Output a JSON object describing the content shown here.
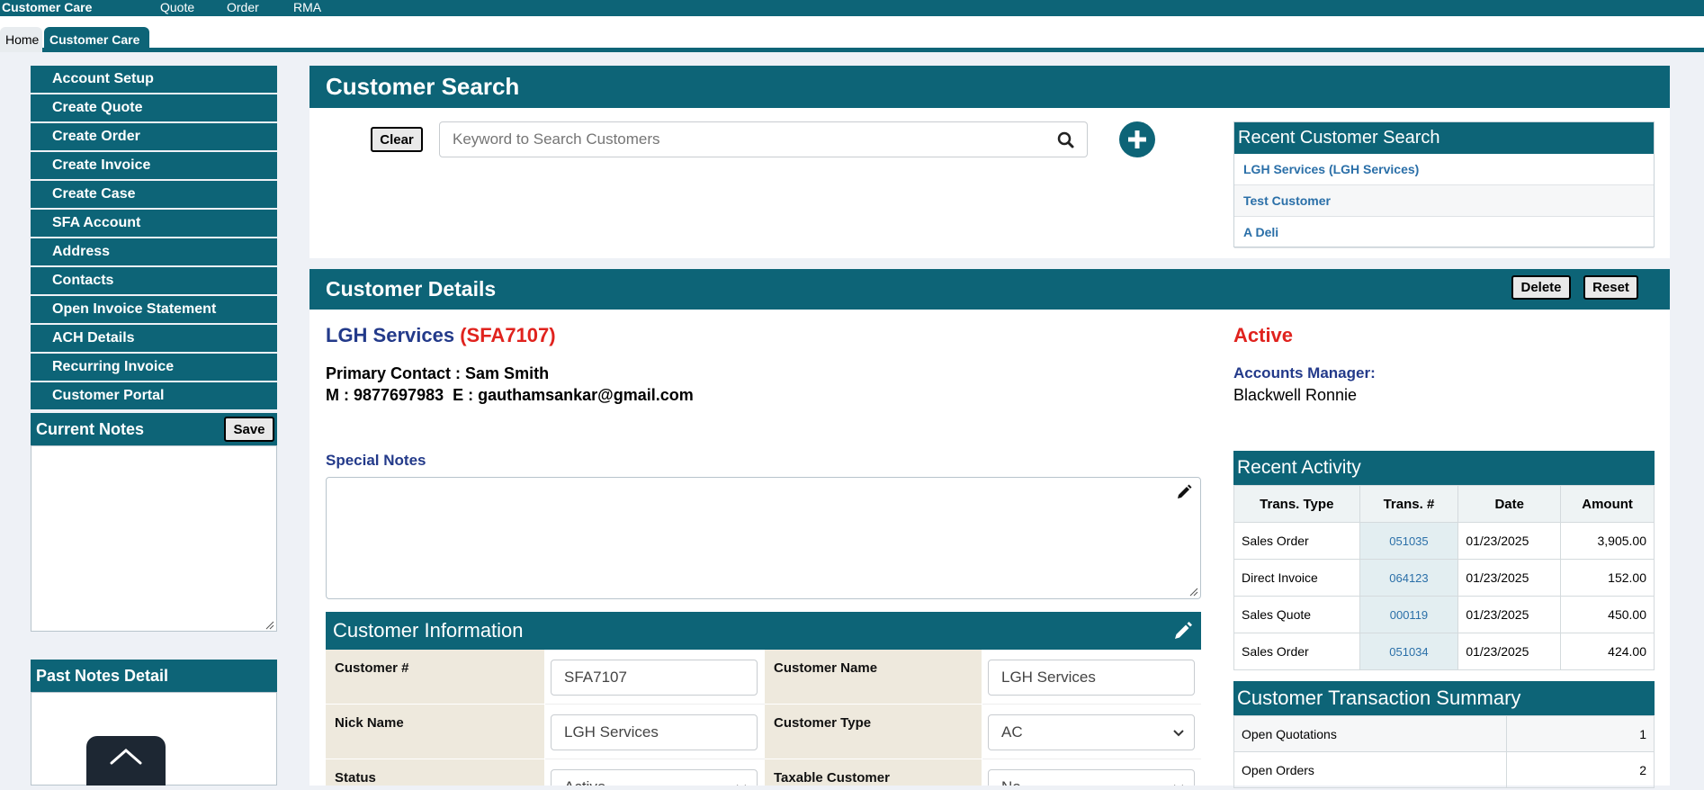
{
  "topbar": {
    "brand": "Customer Care",
    "nav": [
      "Quote",
      "Order",
      "RMA"
    ]
  },
  "tabs": {
    "home": "Home",
    "active": "Customer Care"
  },
  "sidebar": {
    "items": [
      "Account Setup",
      "Create Quote",
      "Create Order",
      "Create Invoice",
      "Create Case",
      "SFA Account",
      "Address",
      "Contacts",
      "Open Invoice Statement",
      "ACH Details",
      "Recurring Invoice",
      "Customer Portal"
    ],
    "current_notes_title": "Current Notes",
    "save_label": "Save",
    "past_notes_title": "Past Notes Detail"
  },
  "search": {
    "title": "Customer Search",
    "clear_label": "Clear",
    "placeholder": "Keyword to Search Customers",
    "recent_title": "Recent Customer Search",
    "recent_items": [
      "LGH Services (LGH Services)",
      "Test Customer",
      "A Deli"
    ]
  },
  "details": {
    "title": "Customer Details",
    "delete_label": "Delete",
    "reset_label": "Reset",
    "customer_name": "LGH Services",
    "customer_code": "(SFA7107)",
    "primary_contact": "Primary Contact : Sam Smith",
    "contact_line": "M : 9877697983  E : gauthamsankar@gmail.com",
    "status": "Active",
    "accounts_manager_label": "Accounts Manager:",
    "accounts_manager": "Blackwell Ronnie",
    "special_notes_label": "Special Notes"
  },
  "customer_info": {
    "title": "Customer Information",
    "rows": [
      {
        "label1": "Customer #",
        "value1": "SFA7107",
        "label2": "Customer Name",
        "value2": "LGH Services",
        "select2": false
      },
      {
        "label1": "Nick Name",
        "value1": "LGH Services",
        "label2": "Customer Type",
        "value2": "AC",
        "select2": true
      },
      {
        "label1": "Status",
        "value1": "Active",
        "label2": "Taxable Customer",
        "value2": "No",
        "select2": true
      }
    ]
  },
  "recent_activity": {
    "title": "Recent Activity",
    "headers": [
      "Trans. Type",
      "Trans. #",
      "Date",
      "Amount"
    ],
    "rows": [
      {
        "type": "Sales Order",
        "num": "051035",
        "date": "01/23/2025",
        "amount": "3,905.00"
      },
      {
        "type": "Direct Invoice",
        "num": "064123",
        "date": "01/23/2025",
        "amount": "152.00"
      },
      {
        "type": "Sales Quote",
        "num": "000119",
        "date": "01/23/2025",
        "amount": "450.00"
      },
      {
        "type": "Sales Order",
        "num": "051034",
        "date": "01/23/2025",
        "amount": "424.00"
      }
    ]
  },
  "transaction_summary": {
    "title": "Customer Transaction Summary",
    "rows": [
      {
        "label": "Open Quotations",
        "value": "1"
      },
      {
        "label": "Open Orders",
        "value": "2"
      }
    ]
  },
  "colors": {
    "primary": "#0d6477",
    "heading_blue": "#233a8a",
    "alert_red": "#e0231e",
    "link_blue": "#2a6fa8"
  }
}
